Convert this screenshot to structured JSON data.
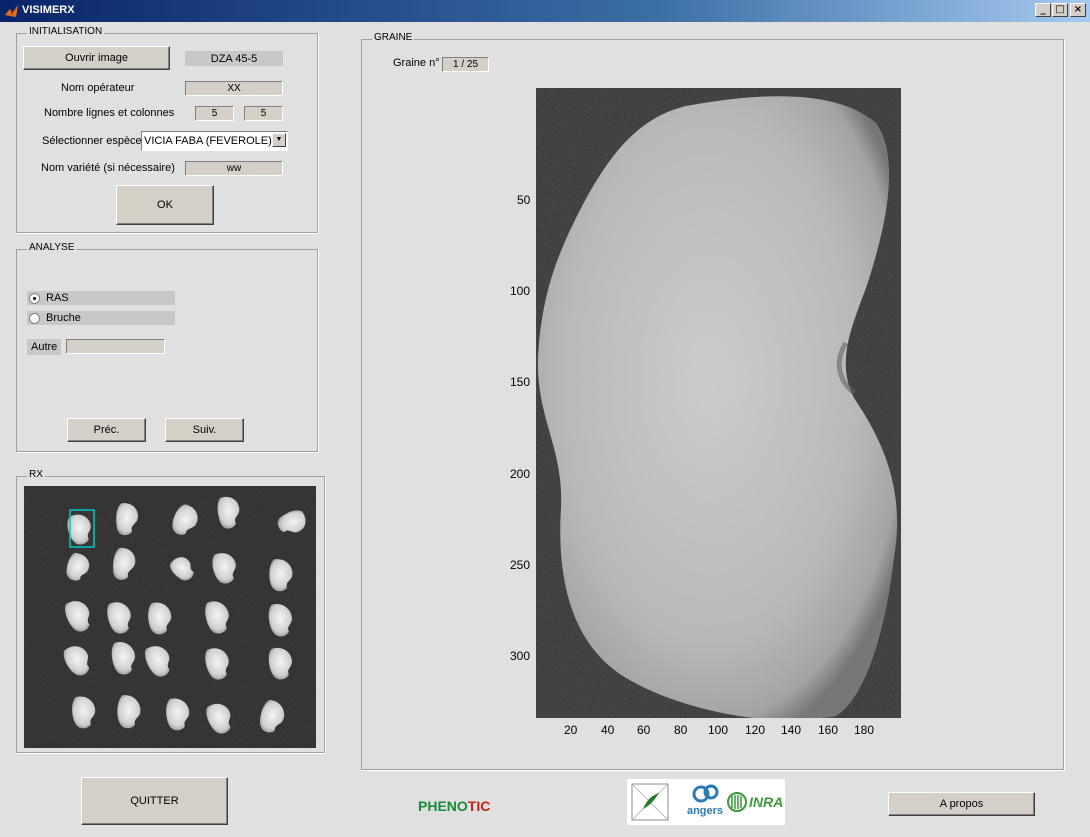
{
  "window": {
    "title": "VISIMERX",
    "min_glyph": "_",
    "max_glyph": "□",
    "close_glyph": "×"
  },
  "init": {
    "title": "INITIALISATION",
    "open_button": "Ouvrir image",
    "file_name": "DZA 45-5",
    "operator_label": "Nom opérateur",
    "operator_value": "XX",
    "rows_cols_label": "Nombre lignes et colonnes",
    "rows": "5",
    "cols": "5",
    "species_label": "Sélectionner espèce",
    "species_value": "VICIA FABA (FEVEROLE)",
    "variety_label": "Nom variété (si nécessaire)",
    "variety_value": "ww",
    "ok_button": "OK"
  },
  "analyse": {
    "title": "ANALYSE",
    "options": [
      {
        "label": "RAS",
        "checked": true
      },
      {
        "label": "Bruche",
        "checked": false
      }
    ],
    "other_label": "Autre",
    "other_value": "",
    "prev_button": "Préc.",
    "next_button": "Suiv."
  },
  "rx": {
    "title": "RX",
    "grid_rows": 5,
    "grid_cols": 5,
    "selected_index": 0
  },
  "graine": {
    "title": "GRAINE",
    "seed_label": "Graine n°",
    "seed_value": "1 / 25",
    "y_ticks": [
      "50",
      "100",
      "150",
      "200",
      "250",
      "300"
    ],
    "x_ticks": [
      "20",
      "40",
      "60",
      "80",
      "100",
      "120",
      "140",
      "160",
      "180"
    ]
  },
  "footer": {
    "quit_button": "QUITTER",
    "phenotic_a": "PHENO",
    "phenotic_b": "TIC",
    "angers_text": "angers",
    "inra_text": "INRA",
    "about_button": "A propos"
  },
  "colors": {
    "accent_title": "#0a246a",
    "phenotic_green": "#1a8a3a",
    "phenotic_red": "#d0201a",
    "selection_cyan": "#00c8c8"
  }
}
